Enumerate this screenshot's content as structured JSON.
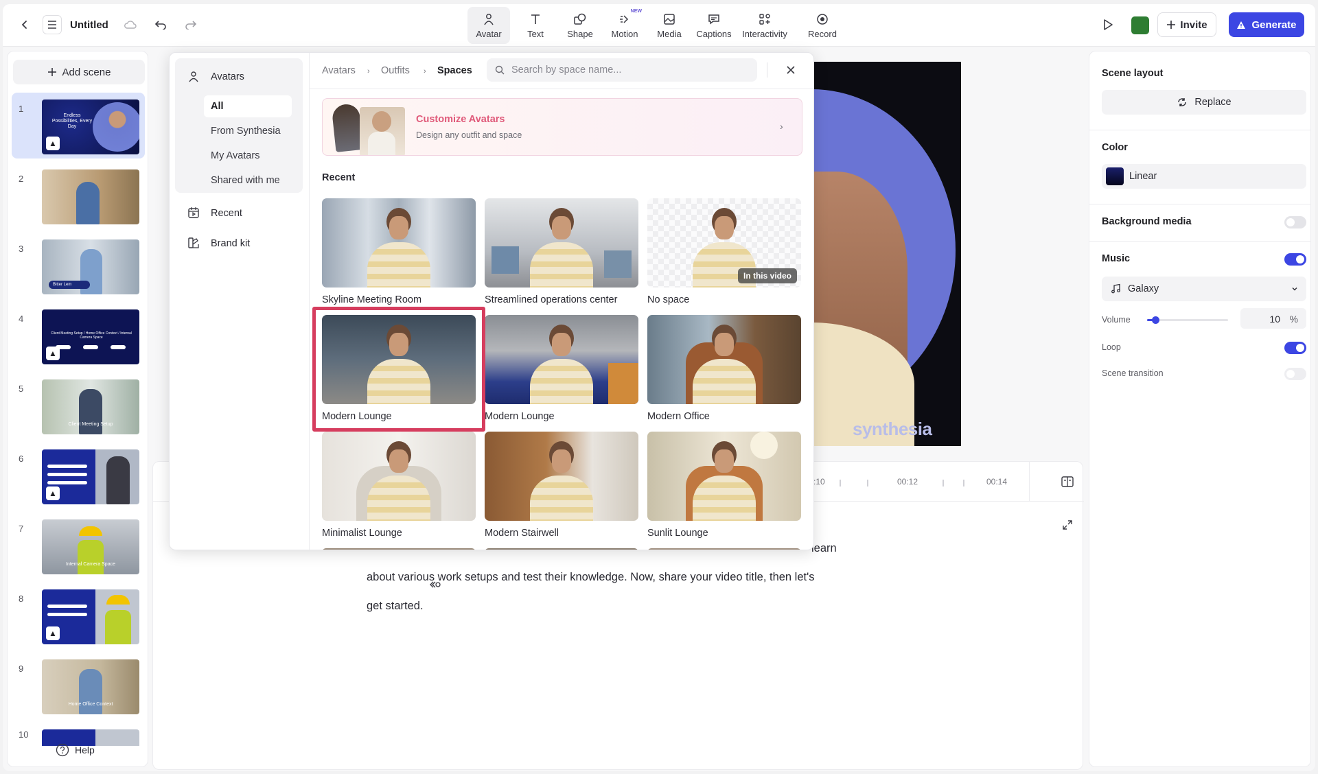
{
  "topbar": {
    "doc_title": "Untitled",
    "tools": [
      {
        "label": "Avatar",
        "icon": "avatar-icon"
      },
      {
        "label": "Text",
        "icon": "text-icon"
      },
      {
        "label": "Shape",
        "icon": "shape-icon"
      },
      {
        "label": "Motion",
        "icon": "motion-icon",
        "badge": "NEW"
      },
      {
        "label": "Media",
        "icon": "media-icon"
      },
      {
        "label": "Captions",
        "icon": "captions-icon"
      },
      {
        "label": "Interactivity",
        "icon": "interactivity-icon"
      },
      {
        "label": "Record",
        "icon": "record-icon"
      }
    ],
    "invite_label": "Invite",
    "generate_label": "Generate",
    "brand_color": "#2e7d32",
    "accent": "#3c46e3"
  },
  "scenes": {
    "add_label": "Add scene",
    "items": [
      {
        "num": "1",
        "caption": "Endless Possibilities, Every Day"
      },
      {
        "num": "2",
        "caption": ""
      },
      {
        "num": "3",
        "caption": "Bitter Lem"
      },
      {
        "num": "4",
        "caption": "Client Meeting Setup / Home Office Context / Internal Camera Space"
      },
      {
        "num": "5",
        "caption": "Client Meeting Setup"
      },
      {
        "num": "6",
        "caption": ""
      },
      {
        "num": "7",
        "caption": "Internal Camera Space"
      },
      {
        "num": "8",
        "caption": ""
      },
      {
        "num": "9",
        "caption": "Home Office Context"
      },
      {
        "num": "10",
        "caption": ""
      }
    ],
    "help_label": "Help"
  },
  "avatar_panel": {
    "categories_header": "Avatars",
    "categories": [
      "All",
      "From Synthesia",
      "My Avatars",
      "Shared with me"
    ],
    "recent_label": "Recent",
    "brand_kit_label": "Brand kit",
    "breadcrumb": [
      "Avatars",
      "Outfits",
      "Spaces"
    ],
    "search_placeholder": "Search by space name...",
    "banner": {
      "title": "Customize Avatars",
      "subtitle": "Design any outfit and space"
    },
    "section_title": "Recent",
    "cards": [
      {
        "label": "Skyline Meeting Room"
      },
      {
        "label": "Streamlined operations center"
      },
      {
        "label": "No space",
        "badge": "In this video"
      },
      {
        "label": "Modern Lounge"
      },
      {
        "label": "Modern Lounge"
      },
      {
        "label": "Modern Office"
      },
      {
        "label": "Minimalist Lounge"
      },
      {
        "label": "Modern Stairwell"
      },
      {
        "label": "Sunlit Lounge"
      }
    ]
  },
  "preview": {
    "watermark": "synthesia"
  },
  "timeline": {
    "ticks": [
      ":10",
      "00:12",
      "00:14"
    ]
  },
  "script": {
    "line1": "learn",
    "line2": "about various work setups and test their knowledge. Now, share your video title, then let's",
    "line3": "get started."
  },
  "right_panel": {
    "scene_layout_title": "Scene layout",
    "replace_label": "Replace",
    "color_title": "Color",
    "color_value": "Linear",
    "background_media_label": "Background media",
    "background_media_on": false,
    "music_title": "Music",
    "music_on": true,
    "music_track": "Galaxy",
    "volume_label": "Volume",
    "volume_value": "10",
    "volume_unit": "%",
    "volume_level": 0.1,
    "loop_label": "Loop",
    "loop_on": true,
    "scene_transition_label": "Scene transition",
    "scene_transition_on": false
  }
}
